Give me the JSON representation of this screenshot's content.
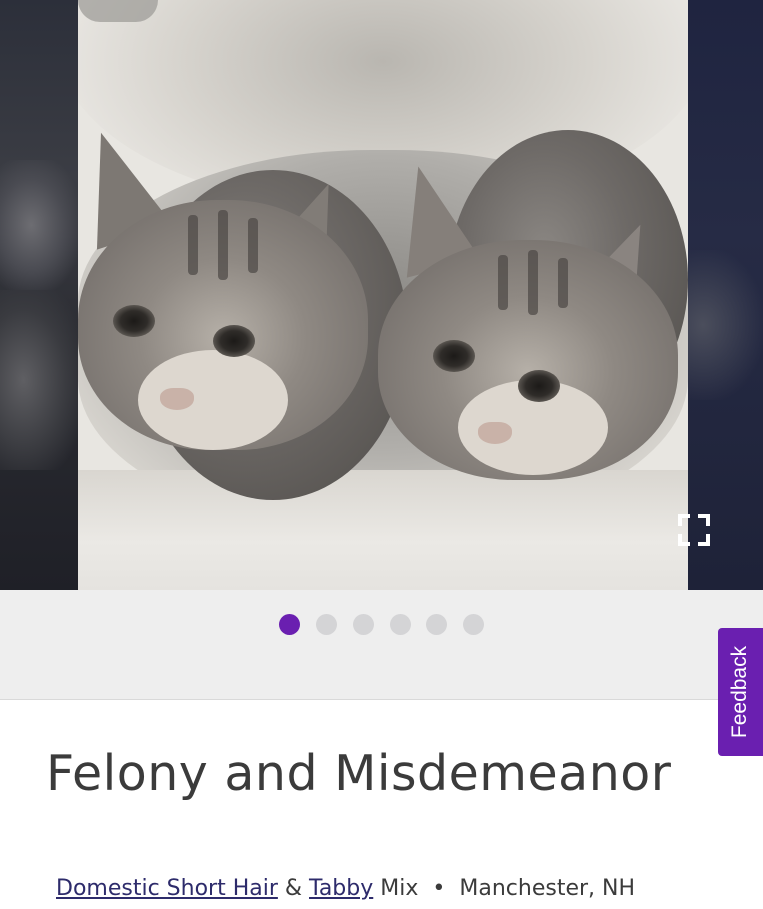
{
  "gallery": {
    "photo_alt": "",
    "expand_icon": "expand-icon",
    "dot_count": 6,
    "active_dot": 0
  },
  "feedback": {
    "label": "Feedback"
  },
  "pet": {
    "name": "Felony and Misdemeanor",
    "breed_primary": "Domestic Short Hair",
    "amp": "&",
    "breed_secondary": "Tabby",
    "mix_label": "Mix",
    "bullet": "•",
    "location": "Manchester, NH"
  },
  "colors": {
    "accent": "#6a1fb0",
    "link": "#2d2b6b",
    "text": "#3b3b3b",
    "dot_inactive": "#d4d4d6",
    "dots_bar_bg": "#eeeeee"
  }
}
